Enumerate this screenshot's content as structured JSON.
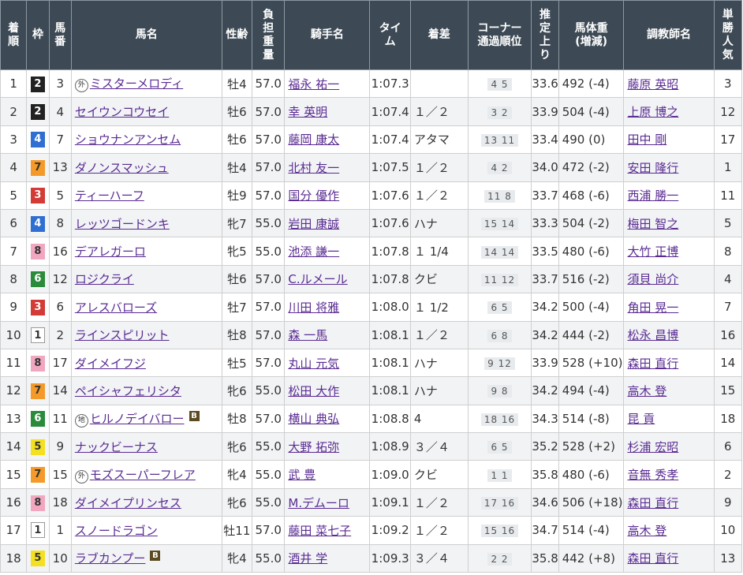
{
  "headers": {
    "rank": "着\n順",
    "waku": "枠",
    "num": "馬\n番",
    "horse": "馬名",
    "sexage": "性齢",
    "weight": "負\n担\n重\n量",
    "jockey": "騎手名",
    "time": "タイ\nム",
    "margin": "着差",
    "corner": "コーナー\n通過順位",
    "last": "推\n定\n上\nり",
    "body": "馬体重\n(増減)",
    "trainer": "調教師名",
    "pop": "単\n勝\n人\n気"
  },
  "colors": {
    "waku": {
      "1": "#ffffff",
      "2": "#222222",
      "3": "#d33b36",
      "4": "#2f6fd1",
      "5": "#f3e021",
      "6": "#2a8b3a",
      "7": "#f49a2a",
      "8": "#f2a7c0"
    },
    "waku_text": {
      "1": "#333333",
      "2": "#ffffff",
      "3": "#ffffff",
      "4": "#ffffff",
      "5": "#333333",
      "6": "#ffffff",
      "7": "#333333",
      "8": "#333333"
    }
  },
  "rows": [
    {
      "rank": "1",
      "waku": "2",
      "num": "3",
      "mark": "外",
      "horse": "ミスターメロディ",
      "blinker": "",
      "sexage": "牡4",
      "weight": "57.0",
      "jockey": "福永 祐一",
      "time": "1:07.3",
      "margin": "",
      "corner": "4 5",
      "last": "33.6",
      "body": "492 (-4)",
      "trainer": "藤原 英昭",
      "pop": "3"
    },
    {
      "rank": "2",
      "waku": "2",
      "num": "4",
      "mark": "",
      "horse": "セイウンコウセイ",
      "blinker": "",
      "sexage": "牡6",
      "weight": "57.0",
      "jockey": "幸 英明",
      "time": "1:07.4",
      "margin": "１／２",
      "corner": "3 2",
      "last": "33.9",
      "body": "504 (-4)",
      "trainer": "上原 博之",
      "pop": "12"
    },
    {
      "rank": "3",
      "waku": "4",
      "num": "7",
      "mark": "",
      "horse": "ショウナンアンセム",
      "blinker": "",
      "sexage": "牡6",
      "weight": "57.0",
      "jockey": "藤岡 康太",
      "time": "1:07.4",
      "margin": "アタマ",
      "corner": "13 11",
      "last": "33.4",
      "body": "490 (0)",
      "trainer": "田中 剛",
      "pop": "17"
    },
    {
      "rank": "4",
      "waku": "7",
      "num": "13",
      "mark": "",
      "horse": "ダノンスマッシュ",
      "blinker": "",
      "sexage": "牡4",
      "weight": "57.0",
      "jockey": "北村 友一",
      "time": "1:07.5",
      "margin": "１／２",
      "corner": "4 2",
      "last": "34.0",
      "body": "472 (-2)",
      "trainer": "安田 隆行",
      "pop": "1"
    },
    {
      "rank": "5",
      "waku": "3",
      "num": "5",
      "mark": "",
      "horse": "ティーハーフ",
      "blinker": "",
      "sexage": "牡9",
      "weight": "57.0",
      "jockey": "国分 優作",
      "time": "1:07.6",
      "margin": "１／２",
      "corner": "11 8",
      "last": "33.7",
      "body": "468 (-6)",
      "trainer": "西浦 勝一",
      "pop": "11"
    },
    {
      "rank": "6",
      "waku": "4",
      "num": "8",
      "mark": "",
      "horse": "レッツゴードンキ",
      "blinker": "",
      "sexage": "牝7",
      "weight": "55.0",
      "jockey": "岩田 康誠",
      "time": "1:07.6",
      "margin": "ハナ",
      "corner": "15 14",
      "last": "33.3",
      "body": "504 (-2)",
      "trainer": "梅田 智之",
      "pop": "5"
    },
    {
      "rank": "7",
      "waku": "8",
      "num": "16",
      "mark": "",
      "horse": "デアレガーロ",
      "blinker": "",
      "sexage": "牝5",
      "weight": "55.0",
      "jockey": "池添 謙一",
      "time": "1:07.8",
      "margin": "１ 1/4",
      "corner": "14 14",
      "last": "33.5",
      "body": "480 (-6)",
      "trainer": "大竹 正博",
      "pop": "8"
    },
    {
      "rank": "8",
      "waku": "6",
      "num": "12",
      "mark": "",
      "horse": "ロジクライ",
      "blinker": "",
      "sexage": "牡6",
      "weight": "57.0",
      "jockey": "C.ルメール",
      "time": "1:07.8",
      "margin": "クビ",
      "corner": "11 12",
      "last": "33.7",
      "body": "516 (-2)",
      "trainer": "須貝 尚介",
      "pop": "4"
    },
    {
      "rank": "9",
      "waku": "3",
      "num": "6",
      "mark": "",
      "horse": "アレスバローズ",
      "blinker": "",
      "sexage": "牡7",
      "weight": "57.0",
      "jockey": "川田 将雅",
      "time": "1:08.0",
      "margin": "１ 1/2",
      "corner": "6 5",
      "last": "34.2",
      "body": "500 (-4)",
      "trainer": "角田 晃一",
      "pop": "7"
    },
    {
      "rank": "10",
      "waku": "1",
      "num": "2",
      "mark": "",
      "horse": "ラインスピリット",
      "blinker": "",
      "sexage": "牡8",
      "weight": "57.0",
      "jockey": "森 一馬",
      "time": "1:08.1",
      "margin": "１／２",
      "corner": "6 8",
      "last": "34.2",
      "body": "444 (-2)",
      "trainer": "松永 昌博",
      "pop": "16"
    },
    {
      "rank": "11",
      "waku": "8",
      "num": "17",
      "mark": "",
      "horse": "ダイメイフジ",
      "blinker": "",
      "sexage": "牡5",
      "weight": "57.0",
      "jockey": "丸山 元気",
      "time": "1:08.1",
      "margin": "ハナ",
      "corner": "9 12",
      "last": "33.9",
      "body": "528 (+10)",
      "trainer": "森田 直行",
      "pop": "14"
    },
    {
      "rank": "12",
      "waku": "7",
      "num": "14",
      "mark": "",
      "horse": "ペイシャフェリシタ",
      "blinker": "",
      "sexage": "牝6",
      "weight": "55.0",
      "jockey": "松田 大作",
      "time": "1:08.1",
      "margin": "ハナ",
      "corner": "9 8",
      "last": "34.2",
      "body": "494 (-4)",
      "trainer": "高木 登",
      "pop": "15"
    },
    {
      "rank": "13",
      "waku": "6",
      "num": "11",
      "mark": "地",
      "horse": "ヒルノデイバロー",
      "blinker": "B",
      "sexage": "牡8",
      "weight": "57.0",
      "jockey": "横山 典弘",
      "time": "1:08.8",
      "margin": "4",
      "corner": "18 16",
      "last": "34.3",
      "body": "514 (-8)",
      "trainer": "昆 貢",
      "pop": "18"
    },
    {
      "rank": "14",
      "waku": "5",
      "num": "9",
      "mark": "",
      "horse": "ナックビーナス",
      "blinker": "",
      "sexage": "牝6",
      "weight": "55.0",
      "jockey": "大野 拓弥",
      "time": "1:08.9",
      "margin": "３／４",
      "corner": "6 5",
      "last": "35.2",
      "body": "528 (+2)",
      "trainer": "杉浦 宏昭",
      "pop": "6"
    },
    {
      "rank": "15",
      "waku": "7",
      "num": "15",
      "mark": "外",
      "horse": "モズスーパーフレア",
      "blinker": "",
      "sexage": "牝4",
      "weight": "55.0",
      "jockey": "武 豊",
      "time": "1:09.0",
      "margin": "クビ",
      "corner": "1 1",
      "last": "35.8",
      "body": "480 (-6)",
      "trainer": "音無 秀孝",
      "pop": "2"
    },
    {
      "rank": "16",
      "waku": "8",
      "num": "18",
      "mark": "",
      "horse": "ダイメイプリンセス",
      "blinker": "",
      "sexage": "牝6",
      "weight": "55.0",
      "jockey": "M.デムーロ",
      "time": "1:09.1",
      "margin": "１／２",
      "corner": "17 16",
      "last": "34.6",
      "body": "506 (+18)",
      "trainer": "森田 直行",
      "pop": "9"
    },
    {
      "rank": "17",
      "waku": "1",
      "num": "1",
      "mark": "",
      "horse": "スノードラゴン",
      "blinker": "",
      "sexage": "牡11",
      "weight": "57.0",
      "jockey": "藤田 菜七子",
      "time": "1:09.2",
      "margin": "１／２",
      "corner": "15 16",
      "last": "34.7",
      "body": "514 (-4)",
      "trainer": "高木 登",
      "pop": "10"
    },
    {
      "rank": "18",
      "waku": "5",
      "num": "10",
      "mark": "",
      "horse": "ラブカンプー",
      "blinker": "B",
      "sexage": "牝4",
      "weight": "55.0",
      "jockey": "酒井 学",
      "time": "1:09.3",
      "margin": "３／４",
      "corner": "2 2",
      "last": "35.8",
      "body": "442 (+8)",
      "trainer": "森田 直行",
      "pop": "13"
    }
  ]
}
